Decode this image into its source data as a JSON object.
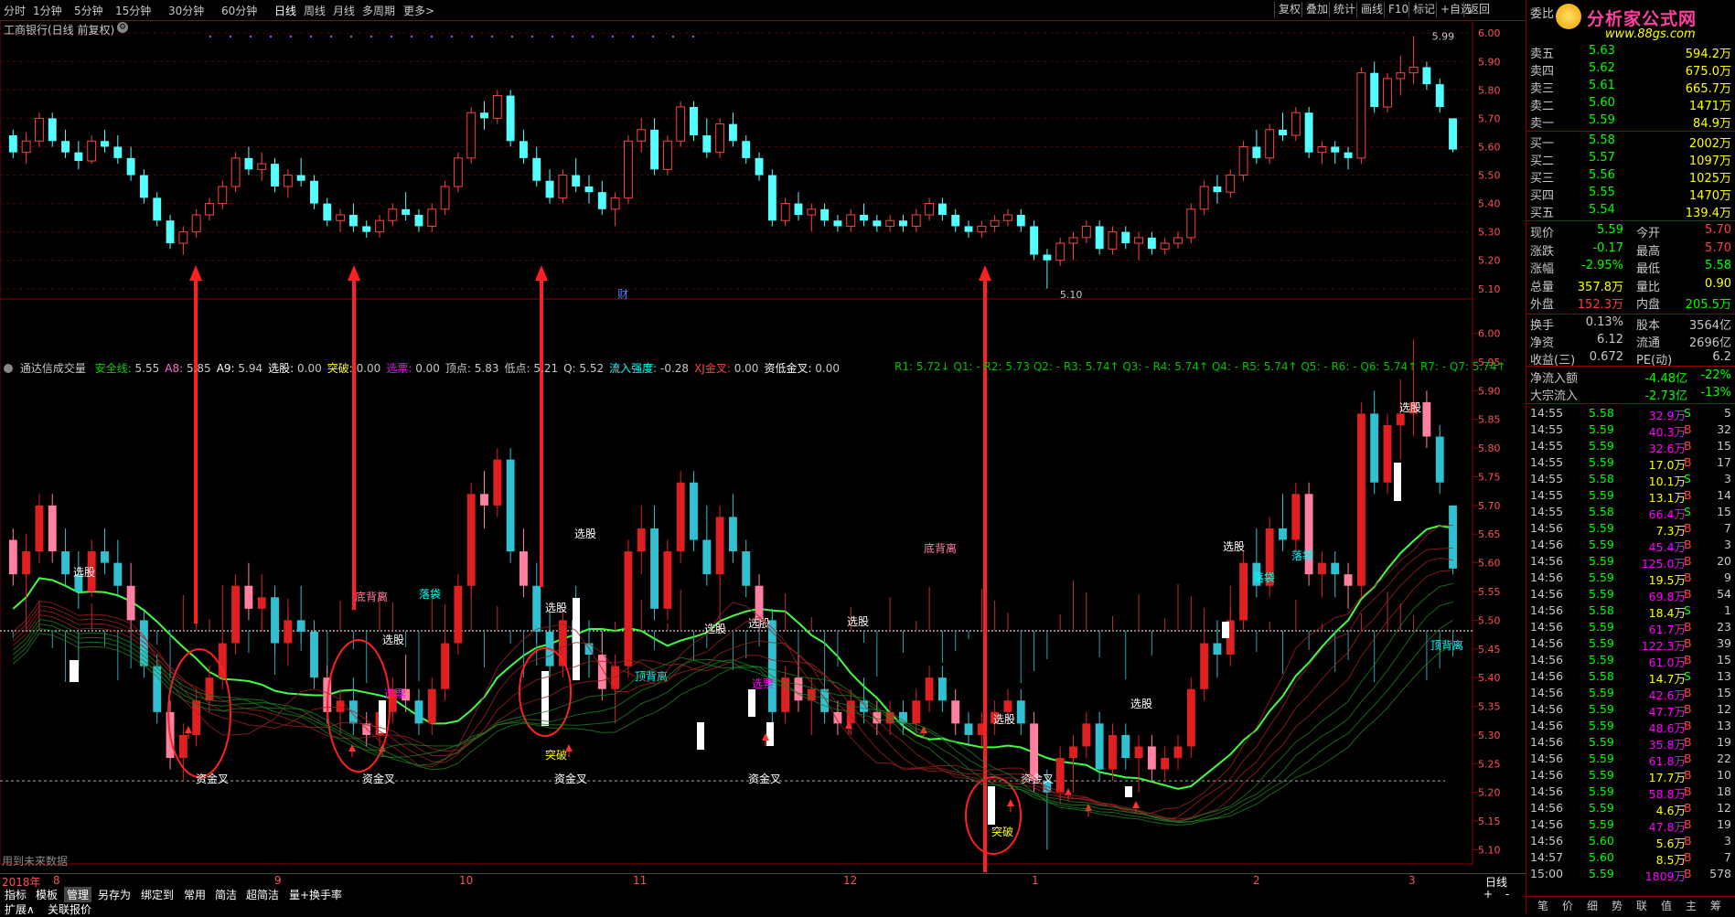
{
  "toolbar": {
    "periods": [
      "分时",
      "1分钟",
      "5分钟",
      "15分钟",
      "30分钟",
      "60分钟",
      "日线",
      "周线",
      "月线",
      "多周期",
      "更多>"
    ],
    "active_period": "日线",
    "right_buttons": [
      "复权",
      "叠加",
      "统计",
      "画线",
      "F10",
      "标记",
      "+自选",
      "返回"
    ]
  },
  "main_chart": {
    "title": "工商银行(日线 前复权)",
    "y_ticks": [
      "6.00",
      "5.90",
      "5.80",
      "5.70",
      "5.60",
      "5.50",
      "5.40",
      "5.30",
      "5.20",
      "5.10"
    ],
    "high_label": "5.99",
    "low_label": "5.10",
    "marker": "财"
  },
  "indicator": {
    "name": "通达信成交量",
    "values": [
      {
        "label": "安全线:",
        "value": "5.55",
        "color": "#00d000"
      },
      {
        "label": "A8:",
        "value": "5.85",
        "color": "#ff6ad5"
      },
      {
        "label": "A9:",
        "value": "5.94",
        "color": "#ffffff"
      },
      {
        "label": "选股:",
        "value": "0.00",
        "color": "#ffffff"
      },
      {
        "label": "突破:",
        "value": "0.00",
        "color": "#ffff00"
      },
      {
        "label": "选票:",
        "value": "0.00",
        "color": "#ff00ff"
      },
      {
        "label": "顶点:",
        "value": "5.83",
        "color": "#c8c8c8"
      },
      {
        "label": "低点:",
        "value": "5.21",
        "color": "#c8c8c8"
      },
      {
        "label": "Q:",
        "value": "5.52",
        "color": "#c8c8c8"
      },
      {
        "label": "流入强度:",
        "value": "-0.28",
        "color": "#00ffff"
      },
      {
        "label": "XJ金叉:",
        "value": "0.00",
        "color": "#ff4040"
      },
      {
        "label": "资低金叉:",
        "value": "0.00",
        "color": "#ffffff"
      }
    ],
    "r_values": "R1: 5.72↓ Q1: - R2: 5.73 Q2: - R3: 5.74↑ Q3: - R4: 5.74↑ Q4: - R5: 5.74↑ Q5: - R6: - Q6: 5.74↑ R7: - Q7: 5.74↑",
    "y_ticks": [
      "6.00",
      "5.95",
      "5.90",
      "5.85",
      "5.80",
      "5.75",
      "5.70",
      "5.65",
      "5.60",
      "5.55",
      "5.50",
      "5.45",
      "5.40",
      "5.35",
      "5.30",
      "5.25",
      "5.20",
      "5.15",
      "5.10"
    ],
    "labels": {
      "xuangu": "选股",
      "dibeili": "底背离",
      "luodai": "落袋",
      "dingbeili": "顶背离",
      "tupo": "突破",
      "zijincha": "资金叉",
      "xuanpiao": "选票"
    },
    "footer_note": "用到未来数据"
  },
  "x_axis": {
    "year": "2018年",
    "months": [
      "8",
      "9",
      "10",
      "11",
      "12",
      "1",
      "2",
      "3"
    ]
  },
  "bottom": {
    "buttons": [
      "指标",
      "模板",
      "管理",
      "另存为",
      "绑定到",
      "常用",
      "简洁",
      "超简洁",
      "量+换手率"
    ],
    "selected": "管理",
    "row2": [
      "扩展∧",
      "关联报价"
    ],
    "period_label": "日线",
    "nav": [
      "+",
      "-"
    ]
  },
  "brand": {
    "logo_text": "分析家公式网",
    "url": "www.88gs.com"
  },
  "quote": {
    "header": "委比",
    "sell": [
      {
        "name": "卖五",
        "price": "5.63",
        "vol": "594.2万"
      },
      {
        "name": "卖四",
        "price": "5.62",
        "vol": "675.0万"
      },
      {
        "name": "卖三",
        "price": "5.61",
        "vol": "665.7万"
      },
      {
        "name": "卖二",
        "price": "5.60",
        "vol": "1471万"
      },
      {
        "name": "卖一",
        "price": "5.59",
        "vol": "84.9万"
      }
    ],
    "buy": [
      {
        "name": "买一",
        "price": "5.58",
        "vol": "2002万"
      },
      {
        "name": "买二",
        "price": "5.57",
        "vol": "1097万"
      },
      {
        "name": "买三",
        "price": "5.56",
        "vol": "1025万"
      },
      {
        "name": "买四",
        "price": "5.55",
        "vol": "1470万"
      },
      {
        "name": "买五",
        "price": "5.54",
        "vol": "139.4万"
      }
    ],
    "stats": [
      {
        "l1": "现价",
        "v1": "5.59",
        "c1": "#00ff00",
        "l2": "今开",
        "v2": "5.70",
        "c2": "#ff4040"
      },
      {
        "l1": "涨跌",
        "v1": "-0.17",
        "c1": "#00ff00",
        "l2": "最高",
        "v2": "5.70",
        "c2": "#ff4040"
      },
      {
        "l1": "涨幅",
        "v1": "-2.95%",
        "c1": "#00ff00",
        "l2": "最低",
        "v2": "5.58",
        "c2": "#00ff00"
      },
      {
        "l1": "总量",
        "v1": "357.8万",
        "c1": "#ffff00",
        "l2": "量比",
        "v2": "0.90",
        "c2": "#ffff00"
      },
      {
        "l1": "外盘",
        "v1": "152.3万",
        "c1": "#ff4040",
        "l2": "内盘",
        "v2": "205.5万",
        "c2": "#00ff00"
      }
    ],
    "stats2": [
      {
        "l1": "换手",
        "v1": "0.13%",
        "l2": "股本",
        "v2": "3564亿"
      },
      {
        "l1": "净资",
        "v1": "6.12",
        "l2": "流通",
        "v2": "2696亿"
      },
      {
        "l1": "收益(三)",
        "v1": "0.672",
        "l2": "PE(动)",
        "v2": "6.2"
      }
    ],
    "flow": [
      {
        "l": "净流入额",
        "v": "-4.48亿",
        "p": "-22%"
      },
      {
        "l": "大宗流入",
        "v": "-2.73亿",
        "p": "-13%"
      }
    ]
  },
  "ticks": [
    {
      "t": "14:55",
      "p": "5.58",
      "v": "32.9万",
      "d": "S",
      "n": "5",
      "vc": "#ff00ff"
    },
    {
      "t": "14:55",
      "p": "5.59",
      "v": "40.3万",
      "d": "B",
      "n": "32",
      "vc": "#ff00ff"
    },
    {
      "t": "14:55",
      "p": "5.59",
      "v": "32.6万",
      "d": "B",
      "n": "15",
      "vc": "#ff00ff"
    },
    {
      "t": "14:55",
      "p": "5.59",
      "v": "17.0万",
      "d": "B",
      "n": "17",
      "vc": "#ffff00"
    },
    {
      "t": "14:55",
      "p": "5.58",
      "v": "10.1万",
      "d": "S",
      "n": "3",
      "vc": "#ffff00"
    },
    {
      "t": "14:55",
      "p": "5.59",
      "v": "13.1万",
      "d": "B",
      "n": "14",
      "vc": "#ffff00"
    },
    {
      "t": "14:55",
      "p": "5.58",
      "v": "66.4万",
      "d": "S",
      "n": "15",
      "vc": "#ff00ff"
    },
    {
      "t": "14:56",
      "p": "5.59",
      "v": "7.3万",
      "d": "B",
      "n": "7",
      "vc": "#ffff00"
    },
    {
      "t": "14:56",
      "p": "5.59",
      "v": "45.4万",
      "d": "B",
      "n": "3",
      "vc": "#ff00ff"
    },
    {
      "t": "14:56",
      "p": "5.59",
      "v": "125.0万",
      "d": "B",
      "n": "20",
      "vc": "#ff00ff"
    },
    {
      "t": "14:56",
      "p": "5.59",
      "v": "19.5万",
      "d": "B",
      "n": "9",
      "vc": "#ffff00"
    },
    {
      "t": "14:56",
      "p": "5.59",
      "v": "69.8万",
      "d": "B",
      "n": "54",
      "vc": "#ff00ff"
    },
    {
      "t": "14:56",
      "p": "5.58",
      "v": "18.4万",
      "d": "S",
      "n": "1",
      "vc": "#ffff00"
    },
    {
      "t": "14:56",
      "p": "5.59",
      "v": "61.7万",
      "d": "B",
      "n": "23",
      "vc": "#ff00ff"
    },
    {
      "t": "14:56",
      "p": "5.59",
      "v": "122.3万",
      "d": "B",
      "n": "39",
      "vc": "#ff00ff"
    },
    {
      "t": "14:56",
      "p": "5.59",
      "v": "61.0万",
      "d": "B",
      "n": "15",
      "vc": "#ff00ff"
    },
    {
      "t": "14:56",
      "p": "5.58",
      "v": "14.7万",
      "d": "S",
      "n": "13",
      "vc": "#ffff00"
    },
    {
      "t": "14:56",
      "p": "5.59",
      "v": "42.6万",
      "d": "B",
      "n": "15",
      "vc": "#ff00ff"
    },
    {
      "t": "14:56",
      "p": "5.59",
      "v": "47.7万",
      "d": "B",
      "n": "12",
      "vc": "#ff00ff"
    },
    {
      "t": "14:56",
      "p": "5.59",
      "v": "48.6万",
      "d": "B",
      "n": "13",
      "vc": "#ff00ff"
    },
    {
      "t": "14:56",
      "p": "5.59",
      "v": "35.8万",
      "d": "B",
      "n": "19",
      "vc": "#ff00ff"
    },
    {
      "t": "14:56",
      "p": "5.59",
      "v": "61.8万",
      "d": "B",
      "n": "22",
      "vc": "#ff00ff"
    },
    {
      "t": "14:56",
      "p": "5.59",
      "v": "17.7万",
      "d": "B",
      "n": "10",
      "vc": "#ffff00"
    },
    {
      "t": "14:56",
      "p": "5.59",
      "v": "58.8万",
      "d": "B",
      "n": "18",
      "vc": "#ff00ff"
    },
    {
      "t": "14:56",
      "p": "5.59",
      "v": "4.6万",
      "d": "B",
      "n": "12",
      "vc": "#ffff00"
    },
    {
      "t": "14:56",
      "p": "5.59",
      "v": "47.8万",
      "d": "B",
      "n": "19",
      "vc": "#ff00ff"
    },
    {
      "t": "14:56",
      "p": "5.60",
      "v": "5.6万",
      "d": "B",
      "n": "3",
      "vc": "#ffff00"
    },
    {
      "t": "14:57",
      "p": "5.60",
      "v": "8.5万",
      "d": "B",
      "n": "7",
      "vc": "#ffff00"
    },
    {
      "t": "15:00",
      "p": "5.59",
      "v": "1809万",
      "d": "B",
      "n": "578",
      "vc": "#ff00ff"
    }
  ],
  "footer_tabs": [
    "笔",
    "价",
    "细",
    "势",
    "联",
    "值",
    "主",
    "筹"
  ],
  "chart_data": {
    "type": "candlestick",
    "ylim": [
      5.08,
      6.02
    ],
    "ohlc": [
      [
        5.64,
        5.66,
        5.56,
        5.58
      ],
      [
        5.58,
        5.65,
        5.54,
        5.62
      ],
      [
        5.62,
        5.72,
        5.6,
        5.7
      ],
      [
        5.7,
        5.72,
        5.6,
        5.62
      ],
      [
        5.62,
        5.66,
        5.56,
        5.58
      ],
      [
        5.58,
        5.62,
        5.52,
        5.55
      ],
      [
        5.55,
        5.64,
        5.54,
        5.62
      ],
      [
        5.62,
        5.66,
        5.58,
        5.6
      ],
      [
        5.6,
        5.64,
        5.54,
        5.56
      ],
      [
        5.56,
        5.6,
        5.48,
        5.5
      ],
      [
        5.5,
        5.52,
        5.4,
        5.42
      ],
      [
        5.42,
        5.44,
        5.32,
        5.34
      ],
      [
        5.34,
        5.36,
        5.24,
        5.26
      ],
      [
        5.26,
        5.32,
        5.22,
        5.3
      ],
      [
        5.3,
        5.38,
        5.28,
        5.36
      ],
      [
        5.36,
        5.42,
        5.34,
        5.4
      ],
      [
        5.4,
        5.48,
        5.38,
        5.46
      ],
      [
        5.46,
        5.58,
        5.44,
        5.56
      ],
      [
        5.56,
        5.6,
        5.5,
        5.52
      ],
      [
        5.52,
        5.58,
        5.48,
        5.54
      ],
      [
        5.54,
        5.56,
        5.44,
        5.46
      ],
      [
        5.46,
        5.52,
        5.42,
        5.5
      ],
      [
        5.5,
        5.56,
        5.46,
        5.48
      ],
      [
        5.48,
        5.5,
        5.38,
        5.4
      ],
      [
        5.4,
        5.42,
        5.32,
        5.34
      ],
      [
        5.34,
        5.38,
        5.3,
        5.36
      ],
      [
        5.36,
        5.4,
        5.3,
        5.32
      ],
      [
        5.32,
        5.34,
        5.28,
        5.3
      ],
      [
        5.3,
        5.36,
        5.28,
        5.34
      ],
      [
        5.34,
        5.4,
        5.32,
        5.38
      ],
      [
        5.38,
        5.44,
        5.34,
        5.36
      ],
      [
        5.36,
        5.38,
        5.3,
        5.32
      ],
      [
        5.32,
        5.4,
        5.3,
        5.38
      ],
      [
        5.38,
        5.48,
        5.36,
        5.46
      ],
      [
        5.46,
        5.58,
        5.44,
        5.56
      ],
      [
        5.56,
        5.74,
        5.54,
        5.72
      ],
      [
        5.72,
        5.76,
        5.66,
        5.7
      ],
      [
        5.7,
        5.8,
        5.68,
        5.78
      ],
      [
        5.78,
        5.8,
        5.6,
        5.62
      ],
      [
        5.62,
        5.66,
        5.54,
        5.56
      ],
      [
        5.56,
        5.6,
        5.46,
        5.48
      ],
      [
        5.48,
        5.52,
        5.4,
        5.42
      ],
      [
        5.42,
        5.52,
        5.4,
        5.5
      ],
      [
        5.5,
        5.56,
        5.44,
        5.46
      ],
      [
        5.46,
        5.5,
        5.4,
        5.44
      ],
      [
        5.44,
        5.48,
        5.36,
        5.38
      ],
      [
        5.38,
        5.44,
        5.32,
        5.42
      ],
      [
        5.42,
        5.64,
        5.4,
        5.62
      ],
      [
        5.62,
        5.7,
        5.58,
        5.66
      ],
      [
        5.66,
        5.7,
        5.5,
        5.52
      ],
      [
        5.52,
        5.64,
        5.5,
        5.62
      ],
      [
        5.62,
        5.76,
        5.6,
        5.74
      ],
      [
        5.74,
        5.76,
        5.62,
        5.64
      ],
      [
        5.64,
        5.7,
        5.56,
        5.58
      ],
      [
        5.58,
        5.7,
        5.56,
        5.68
      ],
      [
        5.68,
        5.72,
        5.6,
        5.62
      ],
      [
        5.62,
        5.64,
        5.54,
        5.56
      ],
      [
        5.56,
        5.58,
        5.48,
        5.5
      ],
      [
        5.5,
        5.52,
        5.32,
        5.34
      ],
      [
        5.34,
        5.42,
        5.32,
        5.4
      ],
      [
        5.4,
        5.44,
        5.34,
        5.36
      ],
      [
        5.36,
        5.4,
        5.3,
        5.38
      ],
      [
        5.38,
        5.4,
        5.32,
        5.34
      ],
      [
        5.34,
        5.36,
        5.3,
        5.32
      ],
      [
        5.32,
        5.38,
        5.3,
        5.36
      ],
      [
        5.36,
        5.4,
        5.32,
        5.34
      ],
      [
        5.34,
        5.36,
        5.3,
        5.32
      ],
      [
        5.32,
        5.36,
        5.3,
        5.34
      ],
      [
        5.34,
        5.36,
        5.3,
        5.32
      ],
      [
        5.32,
        5.38,
        5.3,
        5.36
      ],
      [
        5.36,
        5.42,
        5.34,
        5.4
      ],
      [
        5.4,
        5.42,
        5.34,
        5.36
      ],
      [
        5.36,
        5.38,
        5.3,
        5.32
      ],
      [
        5.32,
        5.34,
        5.28,
        5.3
      ],
      [
        5.3,
        5.34,
        5.28,
        5.32
      ],
      [
        5.32,
        5.36,
        5.3,
        5.34
      ],
      [
        5.34,
        5.38,
        5.32,
        5.36
      ],
      [
        5.36,
        5.38,
        5.3,
        5.32
      ],
      [
        5.32,
        5.34,
        5.2,
        5.22
      ],
      [
        5.22,
        5.24,
        5.1,
        5.2
      ],
      [
        5.2,
        5.28,
        5.18,
        5.26
      ],
      [
        5.26,
        5.3,
        5.2,
        5.28
      ],
      [
        5.28,
        5.34,
        5.26,
        5.32
      ],
      [
        5.32,
        5.34,
        5.22,
        5.24
      ],
      [
        5.24,
        5.32,
        5.22,
        5.3
      ],
      [
        5.3,
        5.32,
        5.24,
        5.26
      ],
      [
        5.26,
        5.3,
        5.2,
        5.28
      ],
      [
        5.28,
        5.3,
        5.22,
        5.24
      ],
      [
        5.24,
        5.28,
        5.22,
        5.26
      ],
      [
        5.26,
        5.3,
        5.24,
        5.28
      ],
      [
        5.28,
        5.4,
        5.26,
        5.38
      ],
      [
        5.38,
        5.48,
        5.36,
        5.46
      ],
      [
        5.46,
        5.5,
        5.4,
        5.44
      ],
      [
        5.44,
        5.52,
        5.42,
        5.5
      ],
      [
        5.5,
        5.62,
        5.48,
        5.6
      ],
      [
        5.6,
        5.66,
        5.54,
        5.56
      ],
      [
        5.56,
        5.68,
        5.54,
        5.66
      ],
      [
        5.66,
        5.72,
        5.62,
        5.64
      ],
      [
        5.64,
        5.74,
        5.62,
        5.72
      ],
      [
        5.72,
        5.74,
        5.56,
        5.58
      ],
      [
        5.58,
        5.62,
        5.54,
        5.6
      ],
      [
        5.6,
        5.62,
        5.54,
        5.58
      ],
      [
        5.58,
        5.6,
        5.52,
        5.56
      ],
      [
        5.56,
        5.88,
        5.54,
        5.86
      ],
      [
        5.86,
        5.9,
        5.72,
        5.74
      ],
      [
        5.74,
        5.86,
        5.72,
        5.84
      ],
      [
        5.84,
        5.92,
        5.78,
        5.86
      ],
      [
        5.86,
        5.99,
        5.82,
        5.88
      ],
      [
        5.88,
        5.9,
        5.8,
        5.82
      ],
      [
        5.82,
        5.84,
        5.72,
        5.74
      ],
      [
        5.7,
        5.7,
        5.58,
        5.59
      ]
    ]
  }
}
